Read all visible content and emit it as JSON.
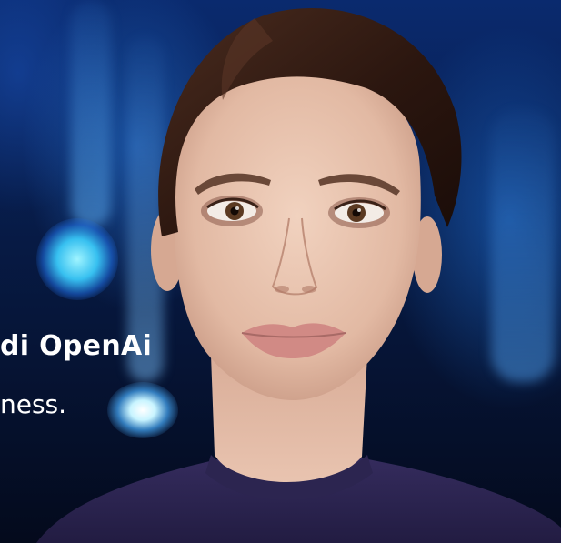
{
  "caption": {
    "headline_fragment": "di OpenAi",
    "subline_fragment": "ness."
  },
  "colors": {
    "background_deep": "#050b1e",
    "glow_blue": "#2a7de1",
    "orb_cyan": "#5fd8ff",
    "hair": "#3a2218",
    "skin": "#e8c3ad",
    "sweater": "#2c2550"
  },
  "illustration": {
    "subject": "digital-human-portrait"
  }
}
